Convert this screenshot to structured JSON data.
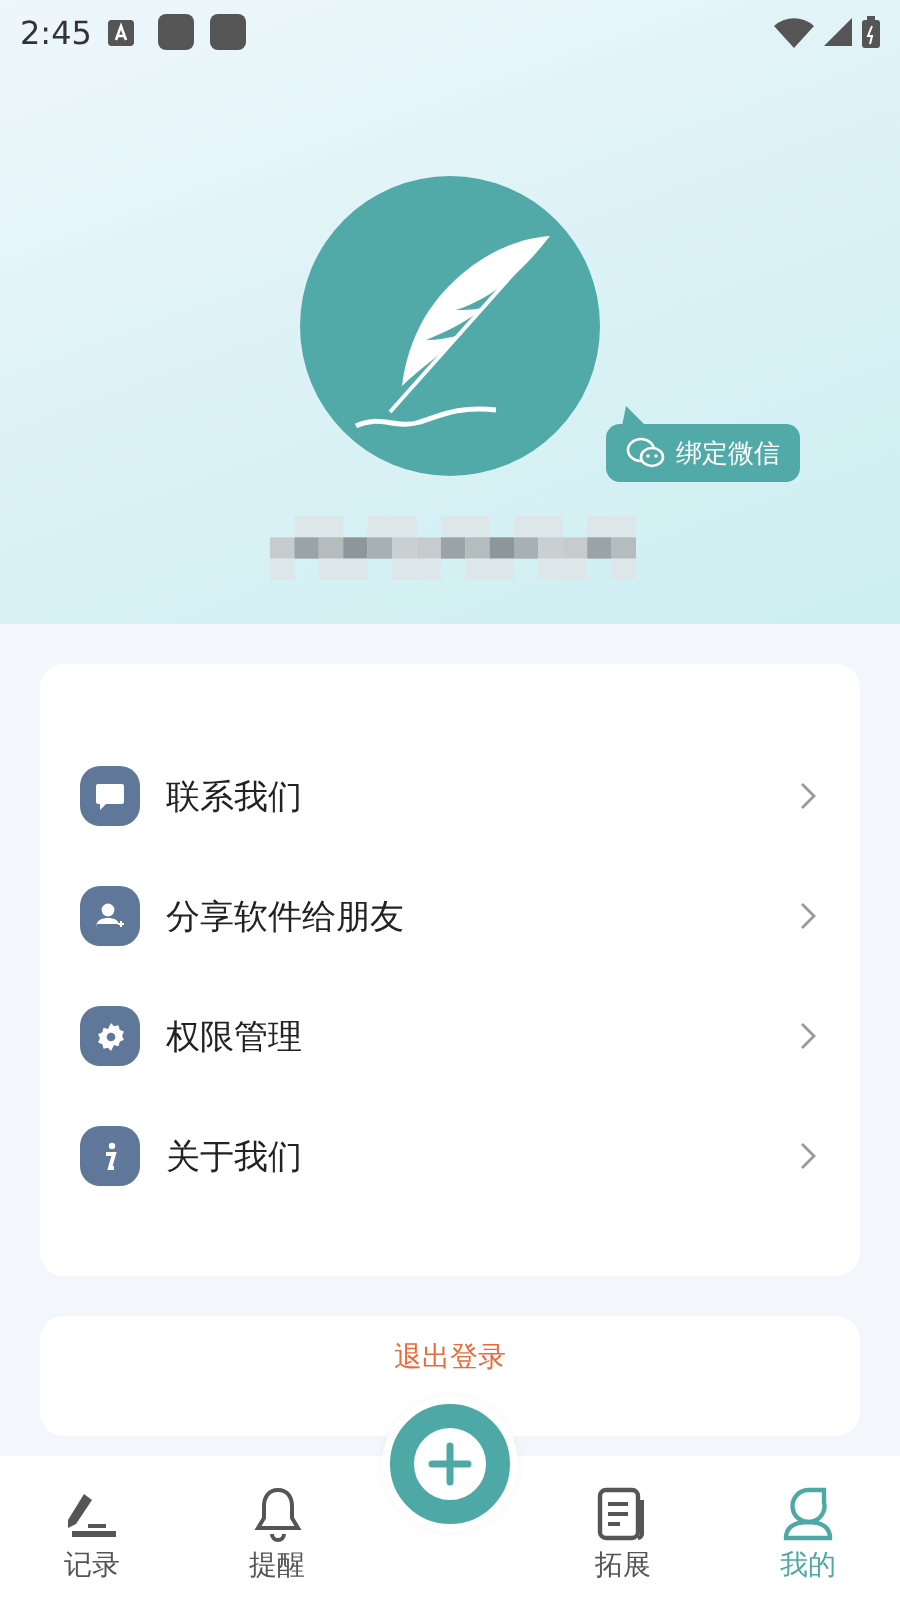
{
  "status_bar": {
    "time": "2:45"
  },
  "profile": {
    "bind_button": "绑定微信"
  },
  "menu": [
    {
      "kind": "message",
      "label": "联系我们"
    },
    {
      "kind": "share",
      "label": "分享软件给朋友"
    },
    {
      "kind": "settings",
      "label": "权限管理"
    },
    {
      "kind": "info",
      "label": "关于我们"
    }
  ],
  "logout": "退出登录",
  "tabs": [
    {
      "kind": "record",
      "label": "记录",
      "selected": false
    },
    {
      "kind": "bell",
      "label": "提醒",
      "selected": false
    },
    {
      "kind": "add",
      "selected": false
    },
    {
      "kind": "doc",
      "label": "拓展",
      "selected": false
    },
    {
      "kind": "person",
      "label": "我的",
      "selected": true
    }
  ]
}
